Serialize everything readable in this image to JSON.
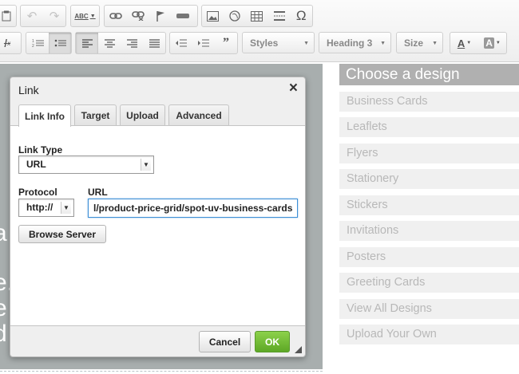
{
  "toolbar": {
    "row1": [
      {
        "icon": "paste-icon"
      },
      {
        "icon": "undo-icon",
        "disabled": true
      },
      {
        "icon": "redo-icon",
        "disabled": true
      },
      {
        "icon": "spellcheck-icon",
        "glyph": "ABC"
      },
      {
        "icon": "link-icon"
      },
      {
        "icon": "unlink-icon"
      },
      {
        "icon": "anchor-flag-icon"
      },
      {
        "icon": "horizontal-rule-icon"
      },
      {
        "icon": "image-icon"
      },
      {
        "icon": "flash-icon"
      },
      {
        "icon": "table-icon"
      },
      {
        "icon": "page-break-icon"
      },
      {
        "icon": "special-char-icon",
        "glyph": "Ω"
      }
    ],
    "row2": [
      {
        "icon": "remove-format-icon"
      },
      {
        "icon": "numbered-list-icon"
      },
      {
        "icon": "bulleted-list-icon",
        "active": true
      },
      {
        "icon": "align-left-icon",
        "active": true
      },
      {
        "icon": "align-center-icon"
      },
      {
        "icon": "align-right-icon"
      },
      {
        "icon": "justify-icon"
      },
      {
        "icon": "outdent-icon"
      },
      {
        "icon": "indent-icon"
      },
      {
        "icon": "blockquote-icon",
        "glyph": "99"
      }
    ],
    "styles_label": "Styles",
    "format_label": "Heading 3",
    "size_label": "Size",
    "text_color_glyph": "A",
    "bg_color_glyph": "A"
  },
  "page": {
    "fragments": [
      "a",
      "e.",
      "e",
      "d"
    ]
  },
  "sidebar": {
    "title": "Choose a design",
    "items": [
      "Business Cards",
      "Leaflets",
      "Flyers",
      "Stationery",
      "Stickers",
      "Invitations",
      "Posters",
      "Greeting Cards",
      "View All Designs",
      "Upload Your Own"
    ]
  },
  "dialog": {
    "title": "Link",
    "tabs": [
      "Link Info",
      "Target",
      "Upload",
      "Advanced"
    ],
    "active_tab": "Link Info",
    "link_type_label": "Link Type",
    "link_type_value": "URL",
    "protocol_label": "Protocol",
    "protocol_value": "http://",
    "url_label": "URL",
    "url_value": "l/product-price-grid/spot-uv-business-cards",
    "browse_button": "Browse Server",
    "cancel_button": "Cancel",
    "ok_button": "OK"
  },
  "colors": {
    "ok_green": "#6ab72e",
    "focus_blue": "#3d8fd6",
    "sidebar_header": "#b0b0b0"
  }
}
